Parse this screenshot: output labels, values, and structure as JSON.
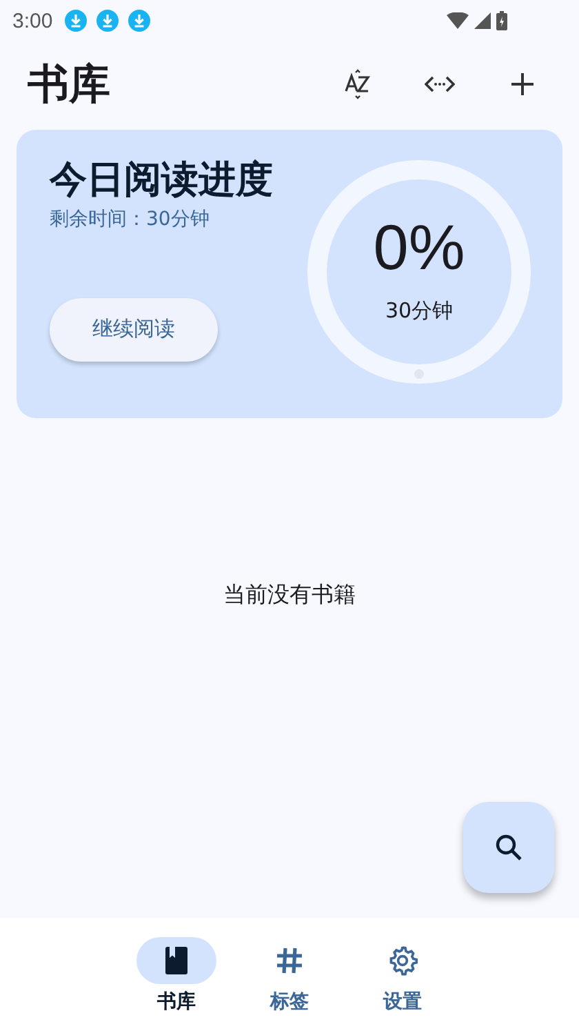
{
  "status_bar": {
    "time": "3:00",
    "notifications": [
      {
        "kind": "download"
      },
      {
        "kind": "download"
      },
      {
        "kind": "download"
      }
    ]
  },
  "app_bar": {
    "title": "书库",
    "actions": [
      {
        "kind": "sort"
      },
      {
        "kind": "code"
      },
      {
        "kind": "add"
      }
    ]
  },
  "reading_card": {
    "title": "今日阅读进度",
    "remaining": "剩余时间：30分钟",
    "button": "继续阅读",
    "progress": {
      "percent": "0%",
      "goal": "30分钟"
    }
  },
  "empty_message": "当前没有书籍",
  "bottom_nav": [
    {
      "label": "书库",
      "kind": "book",
      "selected": true
    },
    {
      "label": "标签",
      "kind": "hash",
      "selected": false
    },
    {
      "label": "设置",
      "kind": "gear",
      "selected": false
    }
  ]
}
